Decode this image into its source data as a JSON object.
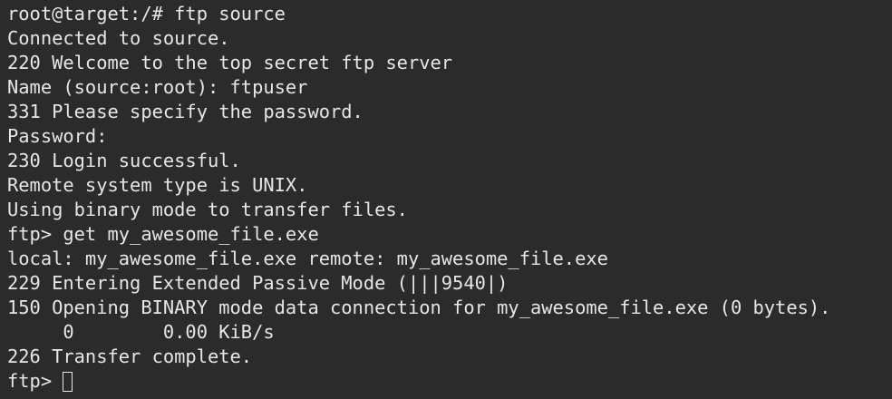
{
  "terminal": {
    "lines": [
      "root@target:/# ftp source",
      "Connected to source.",
      "220 Welcome to the top secret ftp server",
      "Name (source:root): ftpuser",
      "331 Please specify the password.",
      "Password:",
      "230 Login successful.",
      "Remote system type is UNIX.",
      "Using binary mode to transfer files.",
      "ftp> get my_awesome_file.exe",
      "local: my_awesome_file.exe remote: my_awesome_file.exe",
      "229 Entering Extended Passive Mode (|||9540|)",
      "150 Opening BINARY mode data connection for my_awesome_file.exe (0 bytes).",
      "     0        0.00 KiB/s",
      "226 Transfer complete."
    ],
    "prompt": "ftp> ",
    "input_value": ""
  },
  "colors": {
    "background": "#2b2b2b",
    "foreground": "#e6e6e6"
  }
}
